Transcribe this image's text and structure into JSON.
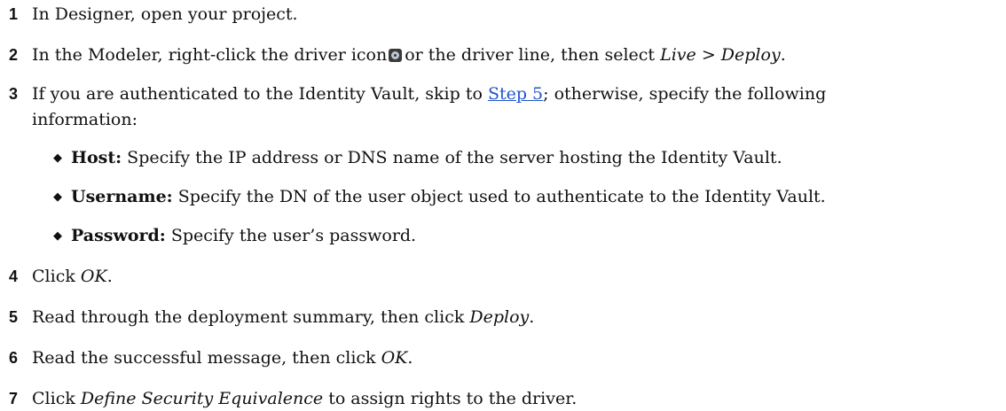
{
  "steps": [
    {
      "num": "1",
      "text": "In Designer, open your project."
    },
    {
      "num": "2",
      "text_a": "In the Modeler, right-click the driver icon",
      "icon": "driver-icon",
      "text_b": "or the driver line, then select",
      "em_a": "Live",
      "sep": ">",
      "em_b": "Deploy",
      "end": "."
    },
    {
      "num": "3",
      "text_a": "If you are authenticated to the Identity Vault, skip to",
      "link": "Step 5",
      "text_b": "; otherwise, specify the following",
      "cont": "information:",
      "bullets": [
        {
          "label": "Host:",
          "text": "Specify the IP address or DNS name of the server hosting the Identity Vault."
        },
        {
          "label": "Username:",
          "text": "Specify the DN of the user object used to authenticate to the Identity Vault."
        },
        {
          "label": "Password:",
          "text": "Specify the user’s password."
        }
      ]
    },
    {
      "num": "4",
      "text_a": "Click",
      "em": "OK",
      "end": "."
    },
    {
      "num": "5",
      "text_a": "Read through the deployment summary, then click",
      "em": "Deploy",
      "end": "."
    },
    {
      "num": "6",
      "text_a": "Read the successful message, then click",
      "em": "OK",
      "end": "."
    },
    {
      "num": "7",
      "text_a": "Click",
      "em": "Define Security Equivalence",
      "text_b": "to assign rights to the driver."
    }
  ],
  "bullet_glyph": "◆",
  "colors": {
    "text": "#111111",
    "link": "#2255cc"
  }
}
